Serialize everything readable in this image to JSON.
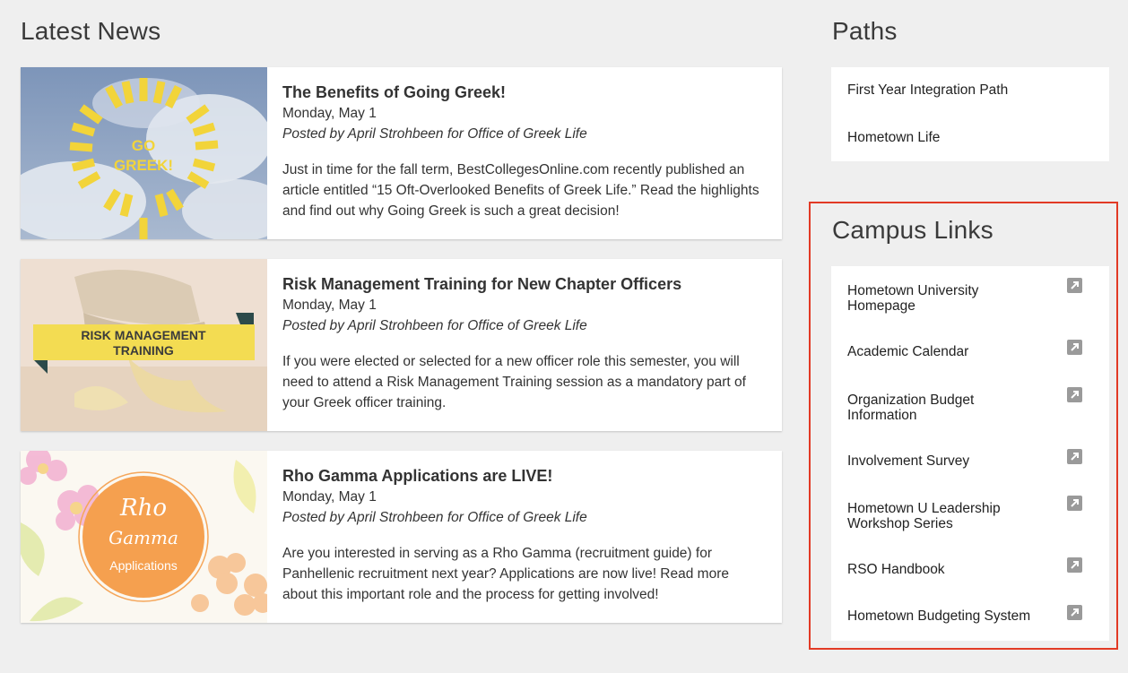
{
  "latest_news": {
    "heading": "Latest News",
    "items": [
      {
        "title": "The Benefits of Going Greek!",
        "date": "Monday, May 1",
        "author": "Posted by April Strohbeen for Office of Greek Life",
        "excerpt": "Just in time for the fall term, BestCollegesOnline.com recently published an article entitled “15 Oft-Overlooked Benefits of Greek Life.” Read the highlights and find out why Going Greek is such a great decision!",
        "image_text": [
          "GO",
          "GREEK!"
        ]
      },
      {
        "title": "Risk Management Training for New Chapter Officers",
        "date": "Monday, May 1",
        "author": "Posted by April Strohbeen for Office of Greek Life",
        "excerpt": "If you were elected or selected for a new officer role this semester, you will need to attend a Risk Management Training session as a mandatory part of your Greek officer training.",
        "image_text": [
          "RISK MANAGEMENT",
          "TRAINING"
        ]
      },
      {
        "title": "Rho Gamma Applications are LIVE!",
        "date": "Monday, May 1",
        "author": "Posted by April Strohbeen for Office of Greek Life",
        "excerpt": "Are you interested in serving as a Rho Gamma (recruitment guide) for Panhellenic recruitment next year? Applications are now live! Read more about this important role and the process for getting involved!",
        "image_text": [
          "Rho",
          "Gamma",
          "Applications"
        ]
      }
    ]
  },
  "paths": {
    "heading": "Paths",
    "items": [
      "First Year Integration Path",
      "Hometown Life"
    ]
  },
  "campus_links": {
    "heading": "Campus Links",
    "items": [
      {
        "label": "Hometown University Homepage",
        "icon": "external-link-icon"
      },
      {
        "label": "Academic Calendar",
        "icon": "external-link-icon"
      },
      {
        "label": "Organization Budget Information",
        "icon": "external-link-icon"
      },
      {
        "label": "Involvement Survey",
        "icon": "external-link-icon"
      },
      {
        "label": "Hometown U Leadership Workshop Series",
        "icon": "external-link-icon"
      },
      {
        "label": "RSO Handbook",
        "icon": "external-link-icon"
      },
      {
        "label": "Hometown Budgeting System",
        "icon": "external-link-icon"
      }
    ]
  },
  "colors": {
    "page_bg": "#efefef",
    "highlight_border": "#e23a25",
    "icon_gray": "#9a9a9a"
  }
}
